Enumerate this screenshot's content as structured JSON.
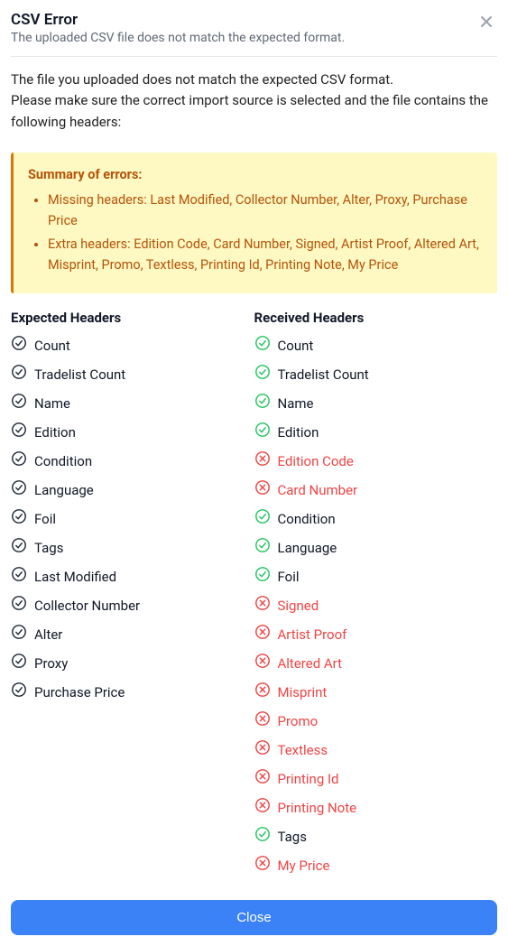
{
  "header": {
    "title": "CSV Error",
    "subtitle": "The uploaded CSV file does not match the expected format."
  },
  "description": {
    "line1": "The file you uploaded does not match the expected CSV format.",
    "line2": "Please make sure the correct import source is selected and the file contains the following headers:"
  },
  "summary": {
    "title": "Summary of errors:",
    "items": [
      "Missing headers: Last Modified, Collector Number, Alter, Proxy, Purchase Price",
      "Extra headers: Edition Code, Card Number, Signed, Artist Proof, Altered Art, Misprint, Promo, Textless, Printing Id, Printing Note, My Price"
    ]
  },
  "columns": {
    "expected": {
      "title": "Expected Headers",
      "items": [
        {
          "label": "Count"
        },
        {
          "label": "Tradelist Count"
        },
        {
          "label": "Name"
        },
        {
          "label": "Edition"
        },
        {
          "label": "Condition"
        },
        {
          "label": "Language"
        },
        {
          "label": "Foil"
        },
        {
          "label": "Tags"
        },
        {
          "label": "Last Modified"
        },
        {
          "label": "Collector Number"
        },
        {
          "label": "Alter"
        },
        {
          "label": "Proxy"
        },
        {
          "label": "Purchase Price"
        }
      ]
    },
    "received": {
      "title": "Received Headers",
      "items": [
        {
          "label": "Count",
          "status": "good"
        },
        {
          "label": "Tradelist Count",
          "status": "good"
        },
        {
          "label": "Name",
          "status": "good"
        },
        {
          "label": "Edition",
          "status": "good"
        },
        {
          "label": "Edition Code",
          "status": "bad"
        },
        {
          "label": "Card Number",
          "status": "bad"
        },
        {
          "label": "Condition",
          "status": "good"
        },
        {
          "label": "Language",
          "status": "good"
        },
        {
          "label": "Foil",
          "status": "good"
        },
        {
          "label": "Signed",
          "status": "bad"
        },
        {
          "label": "Artist Proof",
          "status": "bad"
        },
        {
          "label": "Altered Art",
          "status": "bad"
        },
        {
          "label": "Misprint",
          "status": "bad"
        },
        {
          "label": "Promo",
          "status": "bad"
        },
        {
          "label": "Textless",
          "status": "bad"
        },
        {
          "label": "Printing Id",
          "status": "bad"
        },
        {
          "label": "Printing Note",
          "status": "bad"
        },
        {
          "label": "Tags",
          "status": "good"
        },
        {
          "label": "My Price",
          "status": "bad"
        }
      ]
    }
  },
  "buttons": {
    "close": "Close"
  }
}
